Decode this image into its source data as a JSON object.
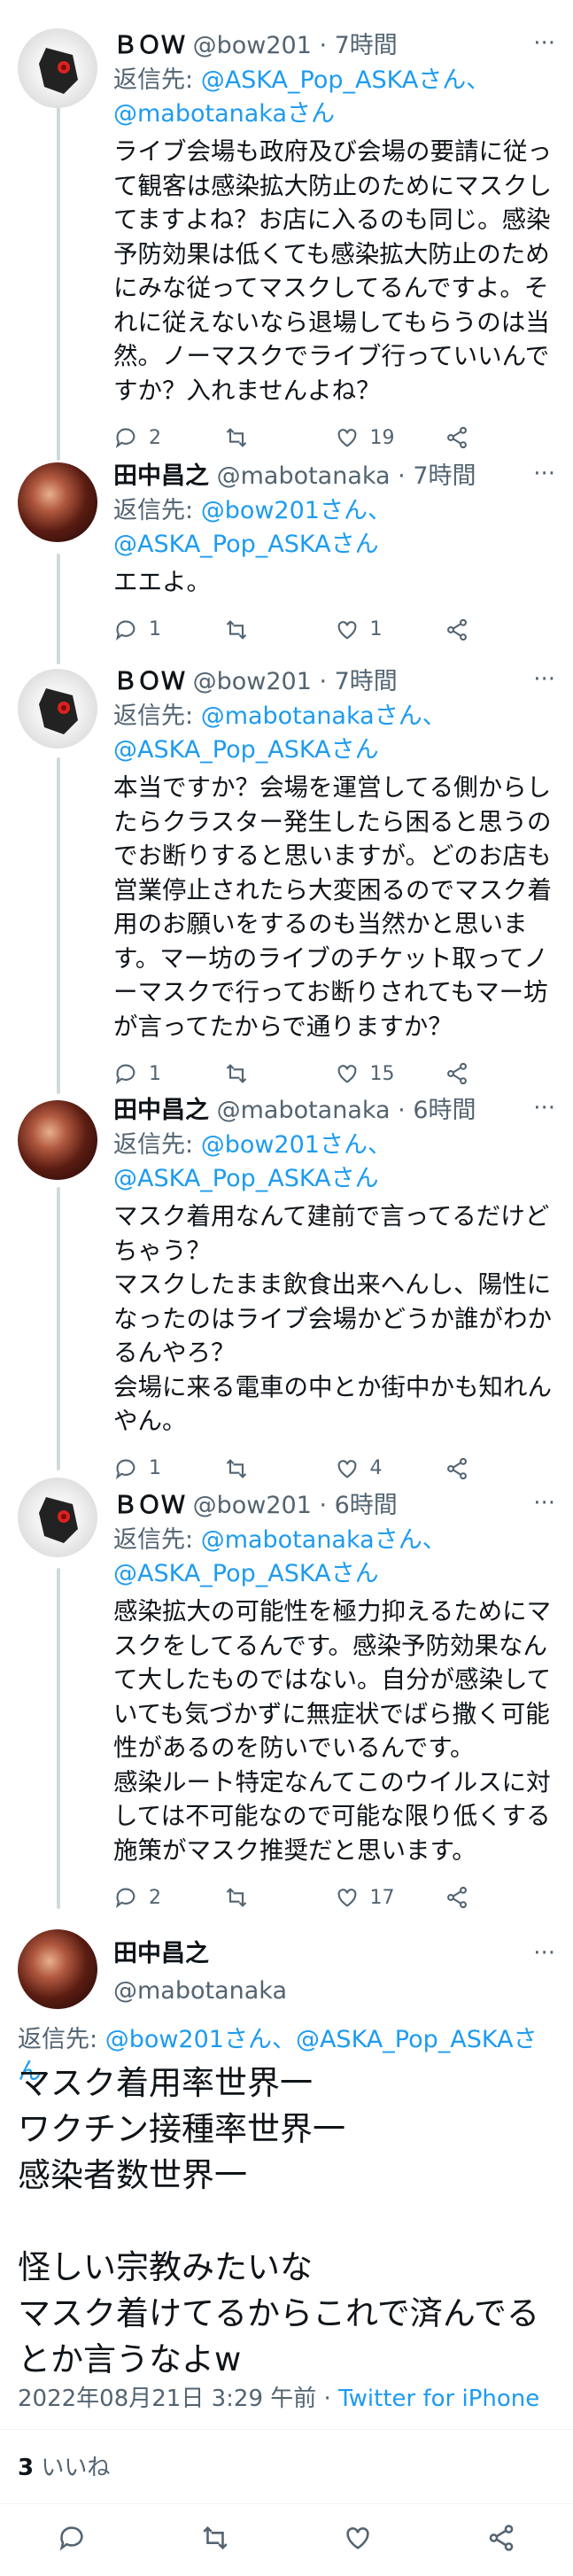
{
  "tweets": [
    {
      "name": "ＢＯＷ",
      "handle": "@bow201 · 7時間",
      "reply_prefix": "返信先: ",
      "reply_mentions": "@ASKA_Pop_ASKAさん、@mabotanakaさん",
      "text": "ライブ会場も政府及び会場の要請に従って観客は感染拡大防止のためにマスクしてますよね？お店に入るのも同じ。感染予防効果は低くても感染拡大防止のためにみな従ってマスクしてるんですよ。それに従えないなら退場してもらうのは当然。ノーマスクでライブ行っていいんですか？入れませんよね？",
      "replies": "2",
      "retweets": "",
      "likes": "19"
    },
    {
      "name": "田中昌之",
      "handle": "@mabotanaka · 7時間",
      "reply_prefix": "返信先: ",
      "reply_mentions": "@bow201さん、@ASKA_Pop_ASKAさん",
      "text": "エエよ。",
      "replies": "1",
      "retweets": "",
      "likes": "1"
    },
    {
      "name": "ＢＯＷ",
      "handle": "@bow201 · 7時間",
      "reply_prefix": "返信先: ",
      "reply_mentions": "@mabotanakaさん、@ASKA_Pop_ASKAさん",
      "text": "本当ですか？会場を運営してる側からしたらクラスター発生したら困ると思うのでお断りすると思いますが。どのお店も営業停止されたら大変困るのでマスク着用のお願いをするのも当然かと思います。マー坊のライブのチケット取ってノーマスクで行ってお断りされてもマー坊が言ってたからで通りますか？",
      "replies": "1",
      "retweets": "",
      "likes": "15"
    },
    {
      "name": "田中昌之",
      "handle": "@mabotanaka · 6時間",
      "reply_prefix": "返信先: ",
      "reply_mentions": "@bow201さん、@ASKA_Pop_ASKAさん",
      "text": "マスク着用なんて建前で言ってるだけどちゃう？\nマスクしたまま飲食出来へんし、陽性になったのはライブ会場かどうか誰がわかるんやろ？\n会場に来る電車の中とか街中かも知れんやん。",
      "replies": "1",
      "retweets": "",
      "likes": "4"
    },
    {
      "name": "ＢＯＷ",
      "handle": "@bow201 · 6時間",
      "reply_prefix": "返信先: ",
      "reply_mentions": "@mabotanakaさん、@ASKA_Pop_ASKAさん",
      "text": "感染拡大の可能性を極力抑えるためにマスクをしてるんです。感染予防効果なんて大したものではない。自分が感染していても気づかずに無症状でばら撒く可能性があるのを防いでいるんです。\n感染ルート特定なんてこのウイルスに対しては不可能なので可能な限り低くする施策がマスク推奨だと思います。",
      "replies": "2",
      "retweets": "",
      "likes": "17"
    }
  ],
  "focus": {
    "name": "田中昌之",
    "handle": "@mabotanaka",
    "reply_prefix": "返信先: ",
    "reply_mentions": "@bow201さん、@ASKA_Pop_ASKAさん",
    "text": "マスク着用率世界一\nワクチン接種率世界一\n感染者数世界一\n\n怪しい宗教みたいな\nマスク着けてるからこれで済んでるとか言うなよw",
    "timestamp": "2022年08月21日 3:29 午前",
    "separator": " · ",
    "client": "Twitter for iPhone",
    "likes_count": "3",
    "likes_label": " いいね"
  },
  "icons": {
    "reply": "reply-icon",
    "retweet": "retweet-icon",
    "like": "heart-icon",
    "share": "share-icon",
    "more": "more-dots-icon"
  },
  "colors": {
    "link": "#1d9bf0",
    "secondary": "#536471",
    "text": "#0f1419",
    "thread_line": "#cfd9de"
  }
}
